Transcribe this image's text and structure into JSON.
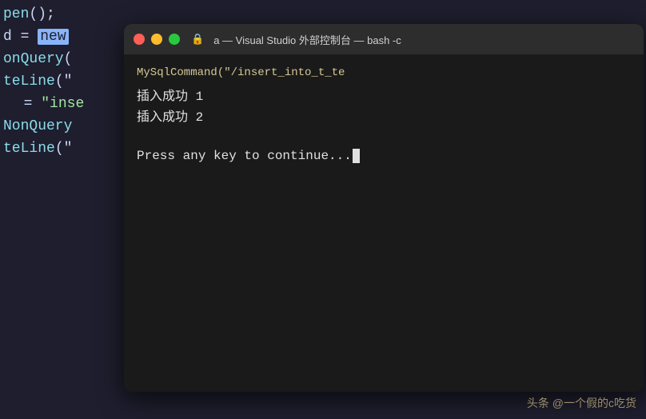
{
  "editor": {
    "lines": [
      {
        "text": "pen();"
      },
      {
        "text": " = ",
        "highlight": "new"
      },
      {
        "text": ""
      },
      {
        "text": "onQuery("
      },
      {
        "text": ""
      },
      {
        "text": "teLine(\""
      },
      {
        "text": ""
      },
      {
        "text": ""
      },
      {
        "text": ""
      },
      {
        "text": " = \"inse"
      },
      {
        "text": "NonQuery"
      },
      {
        "text": ""
      },
      {
        "text": "teLine(\""
      }
    ]
  },
  "terminal": {
    "title": "a — Visual Studio 外部控制台 — bash -c",
    "title_icon": "🔒",
    "cmd_line": "MySqlCommand(\"/insert_into_t_te",
    "output_lines": [
      "插入成功 1",
      "插入成功 2"
    ],
    "press_continue": "Press any key to continue...",
    "traffic_lights": {
      "close": "#ff5f57",
      "minimize": "#febc2e",
      "maximize": "#28c840"
    }
  },
  "watermark": {
    "text": "头条 @一个假的c吃货"
  }
}
